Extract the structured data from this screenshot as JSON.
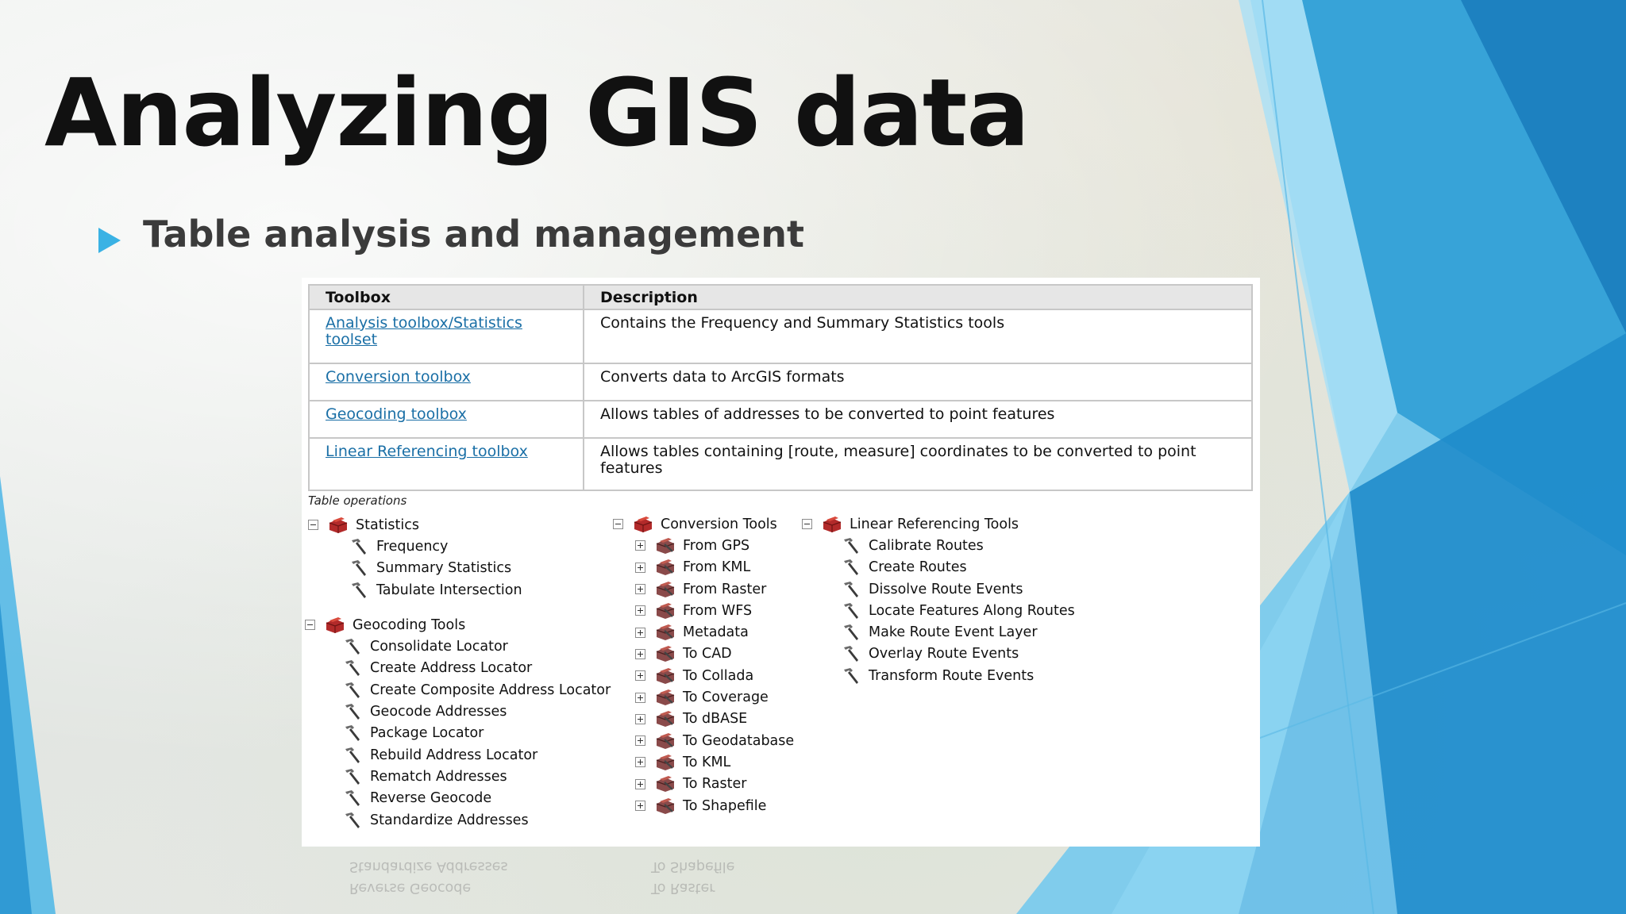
{
  "slide": {
    "title": "Analyzing GIS data",
    "bullet": "Table analysis and management",
    "accent_color": "#3ab2e4"
  },
  "table": {
    "headers": [
      "Toolbox",
      "Description"
    ],
    "rows": [
      {
        "toolbox": "Analysis toolbox/Statistics toolset",
        "description": "Contains the Frequency and Summary Statistics tools"
      },
      {
        "toolbox": "Conversion toolbox",
        "description": "Converts data to ArcGIS formats"
      },
      {
        "toolbox": "Geocoding toolbox",
        "description": "Allows tables of addresses to be converted to point features"
      },
      {
        "toolbox": "Linear Referencing toolbox",
        "description": "Allows tables containing [route, measure] coordinates to be converted to point features"
      }
    ]
  },
  "tree": {
    "caption": "Table operations",
    "statistics": {
      "label": "Statistics",
      "tools": [
        "Frequency",
        "Summary Statistics",
        "Tabulate Intersection"
      ]
    },
    "geocoding": {
      "label": "Geocoding Tools",
      "tools": [
        "Consolidate Locator",
        "Create Address Locator",
        "Create Composite Address Locator",
        "Geocode Addresses",
        "Package Locator",
        "Rebuild Address Locator",
        "Rematch Addresses",
        "Reverse Geocode",
        "Standardize Addresses"
      ]
    },
    "conversion": {
      "label": "Conversion Tools",
      "toolsets": [
        "From GPS",
        "From KML",
        "From Raster",
        "From WFS",
        "Metadata",
        "To CAD",
        "To Collada",
        "To Coverage",
        "To dBASE",
        "To Geodatabase",
        "To KML",
        "To Raster",
        "To Shapefile"
      ]
    },
    "linear_referencing": {
      "label": "Linear Referencing Tools",
      "tools": [
        "Calibrate Routes",
        "Create Routes",
        "Dissolve Route Events",
        "Locate Features Along Routes",
        "Make Route Event Layer",
        "Overlay Route Events",
        "Transform Route Events"
      ]
    }
  },
  "reflection": {
    "left": [
      "Standardize Addresses",
      "Reverse Geocode"
    ],
    "middle": [
      "To Shapefile",
      "To Raster"
    ]
  }
}
